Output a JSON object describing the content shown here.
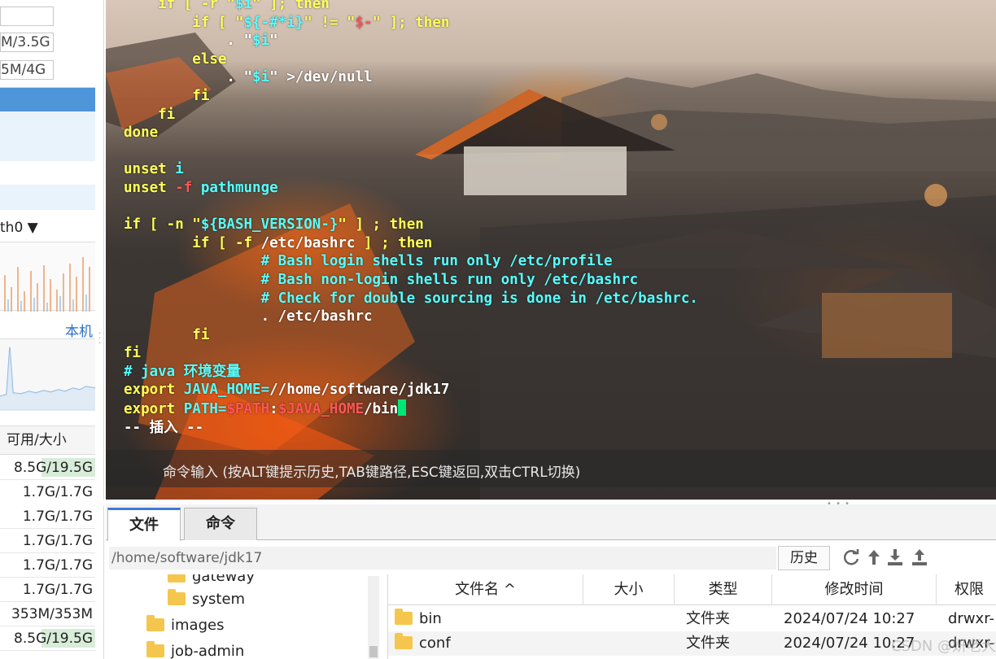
{
  "sidebar": {
    "mem_rows": [
      "M/3.5G",
      "5M/4G"
    ],
    "network_selector": "th0 ▼",
    "network_host": "本机",
    "disk_header": "可用/大小",
    "disk_rows": [
      {
        "text": "8.5G/19.5G",
        "used_fraction": 0.56
      },
      {
        "text": "1.7G/1.7G",
        "used_fraction": 0.0
      },
      {
        "text": "1.7G/1.7G",
        "used_fraction": 0.0
      },
      {
        "text": "1.7G/1.7G",
        "used_fraction": 0.0
      },
      {
        "text": "1.7G/1.7G",
        "used_fraction": 0.0
      },
      {
        "text": "1.7G/1.7G",
        "used_fraction": 0.0
      },
      {
        "text": "353M/353M",
        "used_fraction": 0.0
      },
      {
        "text": "8.5G/19.5G",
        "used_fraction": 0.56
      }
    ]
  },
  "terminal": {
    "lines": [
      [
        {
          "t": "    if [ -r \"",
          "c": "c-kw"
        },
        {
          "t": "$i",
          "c": "c-var"
        },
        {
          "t": "\" ]; then",
          "c": "c-kw"
        }
      ],
      [
        {
          "t": "        if [ \"",
          "c": "c-kw"
        },
        {
          "t": "${-#*i}",
          "c": "c-var"
        },
        {
          "t": "\" != \"",
          "c": "c-kw"
        },
        {
          "t": "$-",
          "c": "c-str"
        },
        {
          "t": "\" ]; then",
          "c": "c-kw"
        }
      ],
      [
        {
          "t": "            . \"",
          "c": "c-txt"
        },
        {
          "t": "$i",
          "c": "c-var"
        },
        {
          "t": "\"",
          "c": "c-txt"
        }
      ],
      [
        {
          "t": "        else",
          "c": "c-kw"
        }
      ],
      [
        {
          "t": "            . \"",
          "c": "c-txt"
        },
        {
          "t": "$i",
          "c": "c-var"
        },
        {
          "t": "\" >/dev/null",
          "c": "c-txt"
        }
      ],
      [
        {
          "t": "        fi",
          "c": "c-kw"
        }
      ],
      [
        {
          "t": "    fi",
          "c": "c-kw"
        }
      ],
      [
        {
          "t": "done",
          "c": "c-kw"
        }
      ],
      [
        {
          "t": "",
          "c": "c-txt"
        }
      ],
      [
        {
          "t": "unset ",
          "c": "c-kw"
        },
        {
          "t": "i",
          "c": "c-var"
        }
      ],
      [
        {
          "t": "unset ",
          "c": "c-kw"
        },
        {
          "t": "-f ",
          "c": "c-str"
        },
        {
          "t": "pathmunge",
          "c": "c-var"
        }
      ],
      [
        {
          "t": "",
          "c": "c-txt"
        }
      ],
      [
        {
          "t": "if [ -n \"",
          "c": "c-kw"
        },
        {
          "t": "${BASH_VERSION-}",
          "c": "c-var"
        },
        {
          "t": "\" ] ; then",
          "c": "c-kw"
        }
      ],
      [
        {
          "t": "        if [ -f ",
          "c": "c-kw"
        },
        {
          "t": "/etc/bashrc",
          "c": "c-txt"
        },
        {
          "t": " ] ; then",
          "c": "c-kw"
        }
      ],
      [
        {
          "t": "                # Bash login shells run only /etc/profile",
          "c": "c-cmt"
        }
      ],
      [
        {
          "t": "                # Bash non-login shells run only /etc/bashrc",
          "c": "c-cmt"
        }
      ],
      [
        {
          "t": "                # Check for double sourcing is done in /etc/bashrc.",
          "c": "c-cmt"
        }
      ],
      [
        {
          "t": "                . /etc/bashrc",
          "c": "c-txt"
        }
      ],
      [
        {
          "t": "        fi",
          "c": "c-kw"
        }
      ],
      [
        {
          "t": "fi",
          "c": "c-kw"
        }
      ],
      [
        {
          "t": "# java 环境变量",
          "c": "c-cmt"
        }
      ],
      [
        {
          "t": "export ",
          "c": "c-kw"
        },
        {
          "t": "JAVA_HOME=",
          "c": "c-var"
        },
        {
          "t": "//home/software/jdk17",
          "c": "c-txt"
        }
      ],
      [
        {
          "t": "export ",
          "c": "c-kw"
        },
        {
          "t": "PATH=",
          "c": "c-var"
        },
        {
          "t": "$PATH",
          "c": "c-str"
        },
        {
          "t": ":",
          "c": "c-txt"
        },
        {
          "t": "$JAVA_HOME",
          "c": "c-str"
        },
        {
          "t": "/bin",
          "c": "c-txt"
        },
        {
          "t": "__CURSOR__",
          "c": "c-txt"
        }
      ],
      [
        {
          "t": "-- 插入 --",
          "c": "c-txt"
        }
      ]
    ],
    "command_hint": "命令输入 (按ALT键提示历史,TAB键路径,ESC键返回,双击CTRL切换)"
  },
  "bottom": {
    "tabs": [
      {
        "label": "文件",
        "active": true
      },
      {
        "label": "命令",
        "active": false
      }
    ],
    "path": "/home/software/jdk17",
    "history_label": "历史",
    "toolbar_icons": [
      "refresh-icon",
      "up-arrow-icon",
      "download-icon",
      "upload-icon"
    ],
    "tree_items": [
      {
        "label": "gateway",
        "indent": 1
      },
      {
        "label": "system",
        "indent": 1
      },
      {
        "label": "images",
        "indent": 0
      },
      {
        "label": "job-admin",
        "indent": 0
      }
    ],
    "file_columns": [
      "文件名 ^",
      "大小",
      "类型",
      "修改时间",
      "权限"
    ],
    "files": [
      {
        "name": "bin",
        "size": "",
        "type": "文件夹",
        "modified": "2024/07/24 10:27",
        "perm": "drwxr-"
      },
      {
        "name": "conf",
        "size": "",
        "type": "文件夹",
        "modified": "2024/07/24 10:27",
        "perm": "drwxr-"
      }
    ],
    "watermark": "CSDN @妍老大"
  }
}
